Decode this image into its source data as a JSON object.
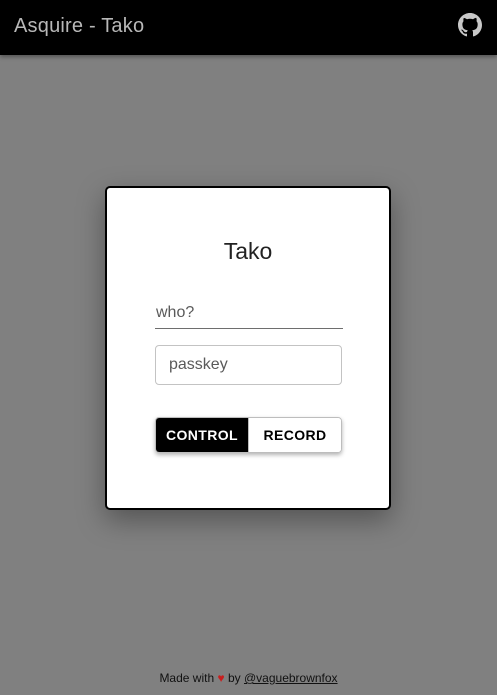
{
  "header": {
    "title": "Asquire - Tako",
    "github_icon": "github-icon"
  },
  "card": {
    "title": "Tako",
    "who_placeholder": "who?",
    "passkey_placeholder": "passkey",
    "mode_toggle": {
      "options": [
        "CONTROL",
        "RECORD"
      ],
      "selected": "CONTROL"
    }
  },
  "footer": {
    "prefix": "Made with",
    "heart": "♥",
    "by": "by",
    "author_link": "@vaguebrownfox"
  },
  "colors": {
    "background": "#808080",
    "topbar": "#000000",
    "heart": "#c81e1e"
  }
}
